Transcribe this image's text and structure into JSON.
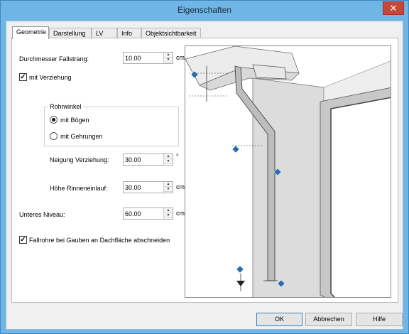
{
  "window": {
    "title": "Eigenschaften",
    "close_label": "✕"
  },
  "tabs": [
    "Geometrie",
    "Darstellung",
    "LV",
    "Info",
    "Objektsichtbarkeit"
  ],
  "fields": {
    "durchmesser": {
      "label": "Durchmesser Fallstrang:",
      "value": "10.00",
      "unit": "cm"
    },
    "neigung": {
      "label": "Neigung Verziehung:",
      "value": "30.00",
      "unit": "°"
    },
    "hoehe": {
      "label": "Höhe Rinneneinlauf:",
      "value": "30.00",
      "unit": "cm"
    },
    "niveau": {
      "label": "Unteres Niveau:",
      "value": "60.00",
      "unit": "cm"
    }
  },
  "checkboxes": {
    "verziehung": {
      "label": "mit Verziehung",
      "checked": true
    },
    "gauben": {
      "label": "Fallrohre bei Gauben an Dachfläche abschneiden",
      "checked": true
    }
  },
  "rohrwinkel": {
    "title": "Rohrwinkel",
    "options": [
      "mit Bögen",
      "mit Gehrungen"
    ],
    "selected": 0
  },
  "buttons": {
    "ok": "OK",
    "cancel": "Abbrechen",
    "help": "Hilfe"
  },
  "colors": {
    "titlebar": "#6fb5e6",
    "close": "#c7463a",
    "marker": "#2a6db0"
  }
}
